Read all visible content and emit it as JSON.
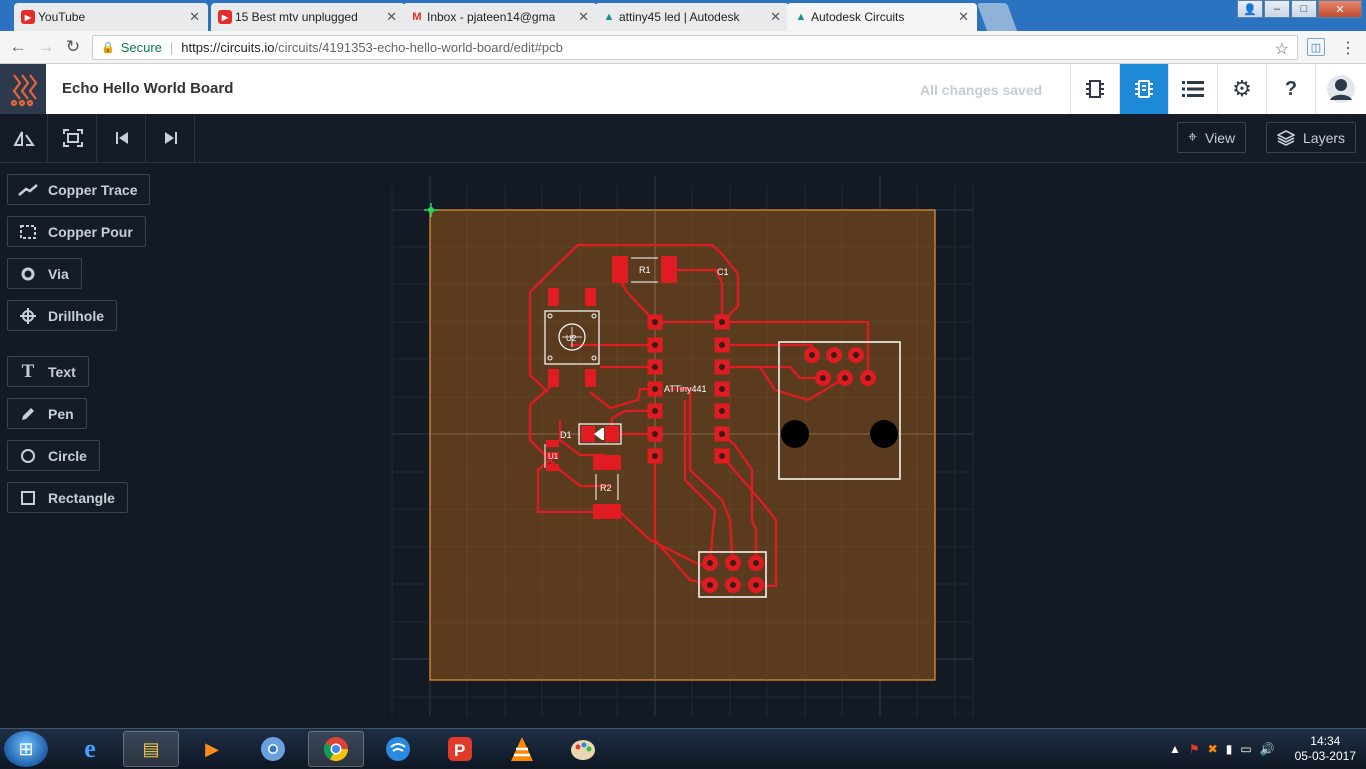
{
  "browser": {
    "tabs": [
      {
        "title": "YouTube",
        "icon": "youtube-icon"
      },
      {
        "title": "15 Best mtv unplugged",
        "icon": "youtube-icon"
      },
      {
        "title": "Inbox - pjateen14@gma",
        "icon": "gmail-icon"
      },
      {
        "title": "attiny45 led | Autodesk",
        "icon": "autodesk-icon"
      },
      {
        "title": "Autodesk Circuits",
        "icon": "autodesk-icon"
      }
    ],
    "secure_label": "Secure",
    "url_base": "https://circuits.io",
    "url_path": "/circuits/4191353-echo-hello-world-board/edit#pcb"
  },
  "app": {
    "title": "Echo Hello World Board",
    "status": "All changes saved",
    "colors": {
      "accent": "#1c8ad6",
      "logo": "#e8643a",
      "board": "#5a3b1e",
      "trace": "#e01b22"
    }
  },
  "toolbar": {
    "view_label": "View",
    "layers_label": "Layers"
  },
  "tools": [
    {
      "label": "Copper Trace",
      "icon": "copper-trace-icon"
    },
    {
      "label": "Copper Pour",
      "icon": "copper-pour-icon"
    },
    {
      "label": "Via",
      "icon": "via-icon"
    },
    {
      "label": "Drillhole",
      "icon": "drillhole-icon"
    },
    {
      "label": "Text",
      "icon": "text-icon"
    },
    {
      "label": "Pen",
      "icon": "pen-icon"
    },
    {
      "label": "Circle",
      "icon": "circle-icon"
    },
    {
      "label": "Rectangle",
      "icon": "rectangle-icon"
    }
  ],
  "pcb": {
    "labels": {
      "r1": "R1",
      "c1": "C1",
      "u2": "U2",
      "attiny": "ATTiny441",
      "d1": "D1",
      "u1": "U1",
      "r2": "R2"
    }
  },
  "taskbar": {
    "time": "14:34",
    "date": "05-03-2017"
  }
}
